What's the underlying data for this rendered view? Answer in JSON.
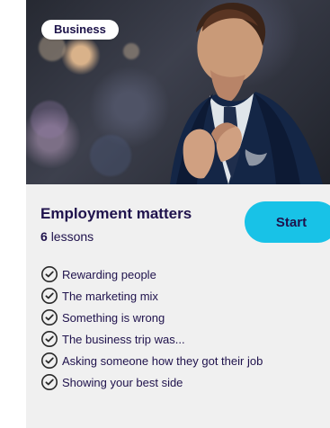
{
  "card": {
    "category": "Business",
    "title": "Employment matters",
    "lesson_count": "6",
    "lesson_label": "lessons",
    "start_label": "Start",
    "lessons": [
      "Rewarding people",
      "The marketing mix",
      "Something is wrong",
      "The business trip was...",
      "Asking someone how they got their job",
      "Showing your best side"
    ]
  },
  "colors": {
    "card_background": "#f0f0f0",
    "text": "#1f124c",
    "start_button": "#18c2e7",
    "badge_background": "#ffffff"
  },
  "icons": {
    "lesson_status": "checkmark-circle-icon"
  }
}
